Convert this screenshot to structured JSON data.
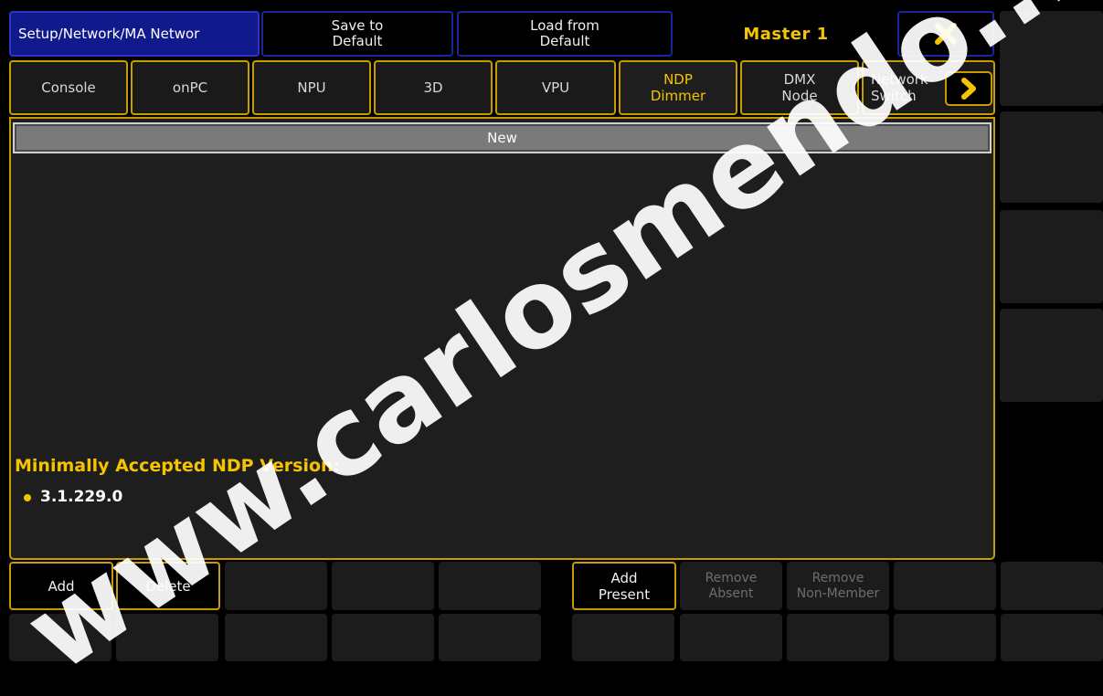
{
  "header": {
    "title": "Setup/Network/MA Networ",
    "save_default": "Save to\nDefault",
    "load_default": "Load from\nDefault",
    "master": "Master 1",
    "close_icon": "close-x-icon"
  },
  "tabs": [
    {
      "label": "Console",
      "active": false
    },
    {
      "label": "onPC",
      "active": false
    },
    {
      "label": "NPU",
      "active": false
    },
    {
      "label": "3D",
      "active": false
    },
    {
      "label": "VPU",
      "active": false
    },
    {
      "label": "NDP\nDimmer",
      "active": true
    },
    {
      "label": "DMX\nNode",
      "active": false
    },
    {
      "label": "Network\nSwitch",
      "active": false
    }
  ],
  "tab_scroll_icon": "chevron-right-icon",
  "list": {
    "new_entry": "New"
  },
  "version": {
    "label": "Minimally Accepted NDP Version:",
    "value": "3.1.229.0"
  },
  "toolbar": {
    "add": "Add",
    "delete": "Delete",
    "add_present": "Add\nPresent",
    "remove_absent": "Remove\nAbsent",
    "remove_non_member": "Remove\nNon-Member"
  },
  "watermark": "www.carlosmendo...",
  "colors": {
    "accent": "#f5c400",
    "title_bg": "#111a8c",
    "panel_bg": "#1e1e1e",
    "border": "#c89a00"
  }
}
